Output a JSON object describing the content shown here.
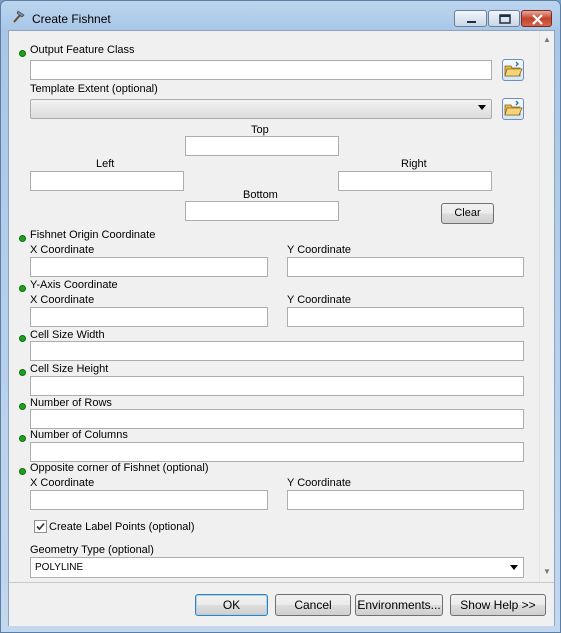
{
  "window": {
    "title": "Create Fishnet",
    "minimize_label": "minimize",
    "maximize_label": "maximize",
    "close_label": "close"
  },
  "form": {
    "output_feature_class": {
      "label": "Output Feature Class",
      "value": ""
    },
    "template_extent": {
      "label": "Template Extent (optional)",
      "selected": "",
      "top_label": "Top",
      "left_label": "Left",
      "right_label": "Right",
      "bottom_label": "Bottom",
      "top_value": "",
      "left_value": "",
      "right_value": "",
      "bottom_value": "",
      "clear_label": "Clear"
    },
    "fishnet_origin": {
      "label": "Fishnet Origin Coordinate",
      "x_label": "X Coordinate",
      "y_label": "Y Coordinate",
      "x_value": "",
      "y_value": ""
    },
    "y_axis": {
      "label": "Y-Axis Coordinate",
      "x_label": "X Coordinate",
      "y_label": "Y Coordinate",
      "x_value": "",
      "y_value": ""
    },
    "cell_size_width": {
      "label": "Cell Size Width",
      "value": ""
    },
    "cell_size_height": {
      "label": "Cell Size Height",
      "value": ""
    },
    "number_of_rows": {
      "label": "Number of Rows",
      "value": ""
    },
    "number_of_columns": {
      "label": "Number of Columns",
      "value": ""
    },
    "opposite_corner": {
      "label": "Opposite corner of Fishnet (optional)",
      "x_label": "X Coordinate",
      "y_label": "Y Coordinate",
      "x_value": "",
      "y_value": ""
    },
    "create_label_points": {
      "label": "Create Label Points (optional)",
      "checked": true
    },
    "geometry_type": {
      "label": "Geometry Type (optional)",
      "selected": "POLYLINE"
    }
  },
  "footer": {
    "ok_label": "OK",
    "cancel_label": "Cancel",
    "environments_label": "Environments...",
    "show_help_label": "Show Help >>"
  },
  "colors": {
    "required_dot": "#1ca31c",
    "title_bar": "#a9c6e7",
    "close_button": "#c4432b"
  },
  "icons": {
    "title": "hammer-icon",
    "browse": "open-folder-icon"
  }
}
